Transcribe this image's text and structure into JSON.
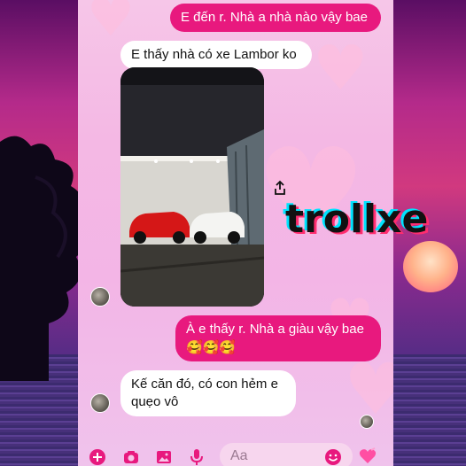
{
  "messages": [
    {
      "text": "E đến r. Nhà a nhà nào vậy bae",
      "side": "sent"
    },
    {
      "text": "E thấy nhà có xe Lambor ko",
      "side": "received"
    },
    {
      "text": "À e thấy r. Nhà a giàu vậy bae",
      "emoji": "🥰🥰🥰",
      "side": "sent"
    },
    {
      "text": "Kế căn đó, có con hẻm e",
      "text2": "quẹo vô",
      "side": "received"
    }
  ],
  "photo": {
    "icon": "car-garage-photo"
  },
  "composer": {
    "placeholder": "Aa"
  },
  "watermark": "trollxe",
  "colors": {
    "sent_bubble": "#e8197e",
    "received_bubble": "#ffffff",
    "chat_bg": "#f4b8e4"
  }
}
